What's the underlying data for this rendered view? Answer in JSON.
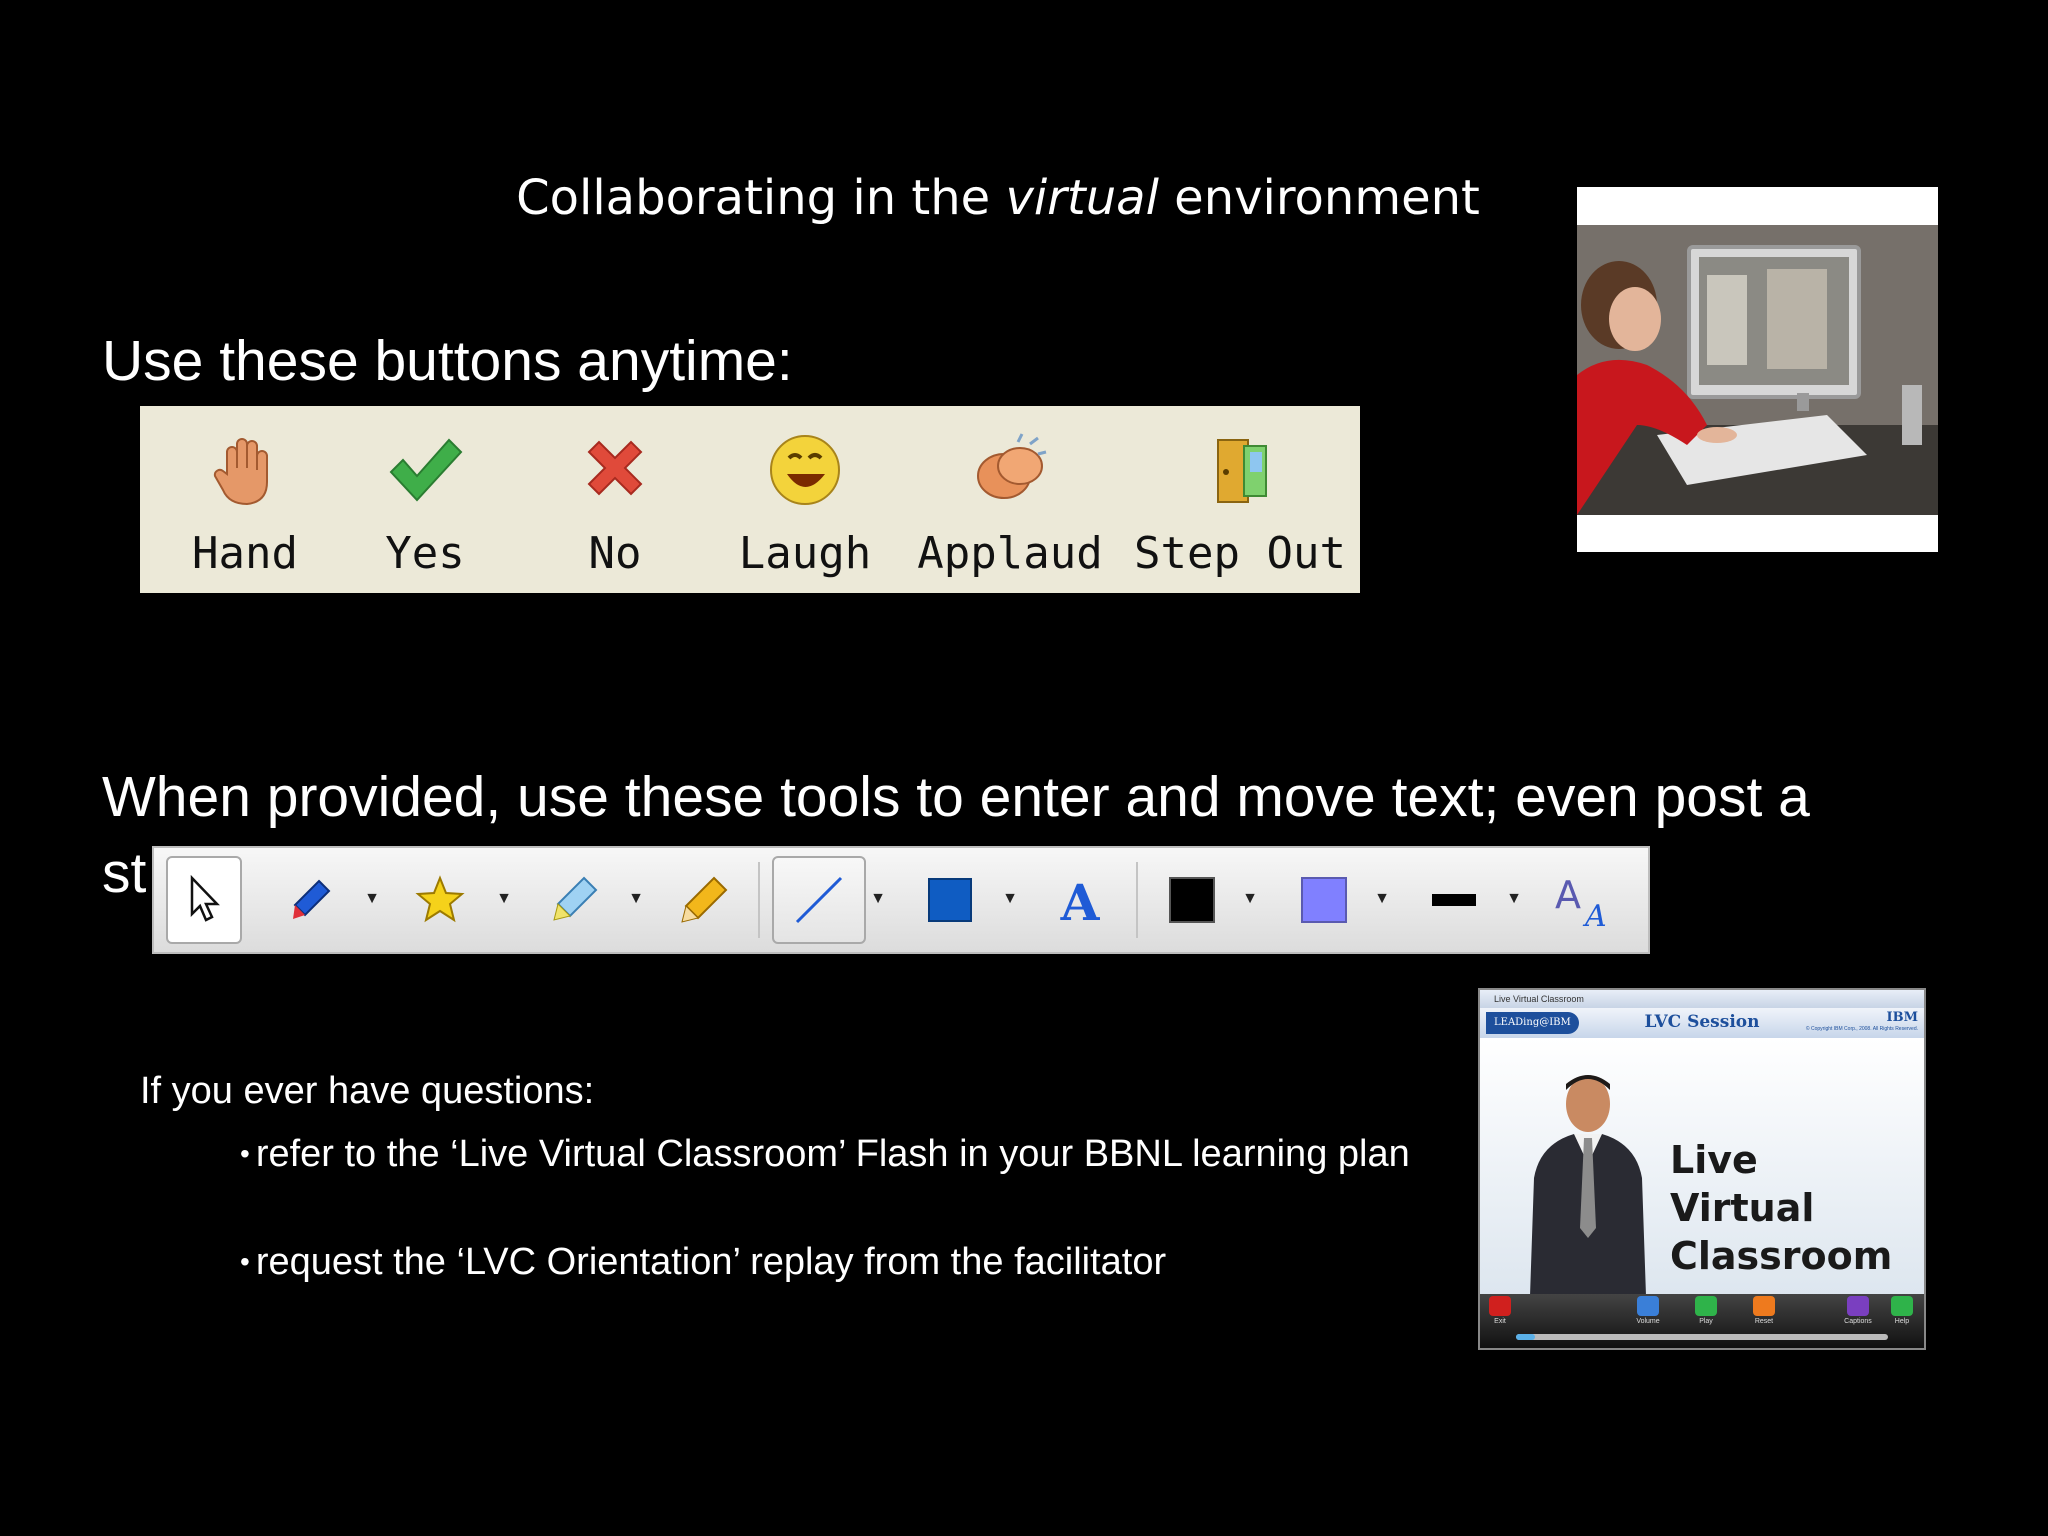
{
  "slide": {
    "title_pre": "Collaborating in the ",
    "title_em": "virtual",
    "title_post": " environment",
    "buttons_heading": "Use these buttons anytime:",
    "tools_heading_line1": "When provided, use these tools to enter and move text; even post a",
    "tools_heading_line2_visible": "st"
  },
  "reaction_buttons": [
    {
      "label": "Hand",
      "icon": "raised-hand-icon"
    },
    {
      "label": "Yes",
      "icon": "green-check-icon"
    },
    {
      "label": "No",
      "icon": "red-x-icon"
    },
    {
      "label": "Laugh",
      "icon": "laughing-face-icon"
    },
    {
      "label": "Applaud",
      "icon": "clapping-hands-icon"
    },
    {
      "label": "Step Out",
      "icon": "door-icon"
    }
  ],
  "whiteboard_tools": [
    {
      "name": "select-pointer-tool",
      "icon": "cursor-arrow-icon",
      "selected": true
    },
    {
      "name": "marker-tool",
      "icon": "marker-pen-icon"
    },
    {
      "name": "stamp-tool",
      "icon": "star-icon"
    },
    {
      "name": "highlighter-tool",
      "icon": "highlighter-icon"
    },
    {
      "name": "eraser-tool",
      "icon": "pencil-icon"
    },
    {
      "name": "line-tool",
      "icon": "line-icon"
    },
    {
      "name": "rectangle-tool",
      "icon": "filled-square-icon"
    },
    {
      "name": "text-tool",
      "icon": "letter-a-icon"
    },
    {
      "name": "line-color",
      "color": "#000000"
    },
    {
      "name": "fill-color",
      "color": "#8080ff"
    },
    {
      "name": "line-width",
      "icon": "line-width-icon"
    },
    {
      "name": "text-size",
      "icon": "font-size-icon"
    }
  ],
  "questions": {
    "heading": "If you ever have questions:",
    "bullets": [
      "refer to the ‘Live Virtual Classroom’ Flash in your BBNL learning plan",
      "request the ‘LVC Orientation’ replay from the facilitator"
    ]
  },
  "lvc_thumbnail": {
    "window_title": "Live Virtual Classroom",
    "logo": "LEADing@IBM",
    "session_title": "LVC Session",
    "brand": "IBM",
    "copyright": "© Copyright IBM Corp., 2008. All Rights Reserved.",
    "big_text": [
      "Live",
      "Virtual",
      "Classroom"
    ],
    "controls": [
      "Exit",
      "Volume",
      "Play",
      "Reset",
      "Captions",
      "Help"
    ],
    "progress": 0.05
  },
  "colors": {
    "background": "#000000",
    "text": "#ffffff",
    "panel": "#ece9d8",
    "fill_color_swatch": "#8080ff",
    "lvc_accent": "#1d4f9c"
  }
}
